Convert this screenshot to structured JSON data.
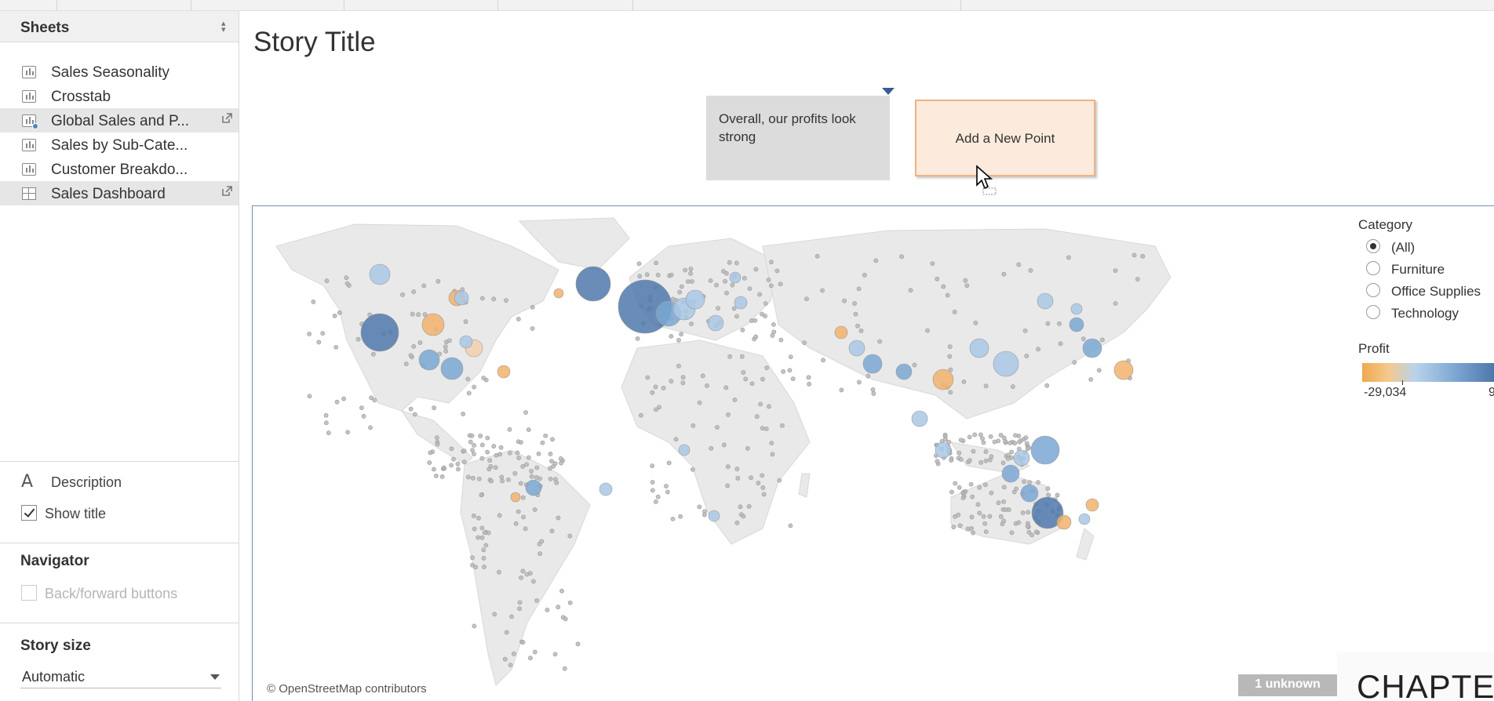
{
  "sidebar": {
    "title": "Sheets",
    "sheets": [
      {
        "label": "Sales Seasonality",
        "kind": "worksheet",
        "selected": false
      },
      {
        "label": "Crosstab",
        "kind": "worksheet",
        "selected": false
      },
      {
        "label": "Global Sales and P...",
        "kind": "worksheet",
        "selected": true
      },
      {
        "label": "Sales by Sub-Cate...",
        "kind": "worksheet",
        "selected": false
      },
      {
        "label": "Customer Breakdo...",
        "kind": "worksheet",
        "selected": false
      },
      {
        "label": "Sales Dashboard",
        "kind": "dashboard",
        "selected": true
      }
    ],
    "description_label": "Description",
    "show_title_label": "Show title",
    "show_title_checked": true,
    "navigator_title": "Navigator",
    "back_forward_label": "Back/forward buttons",
    "story_size_title": "Story size",
    "story_size_value": "Automatic"
  },
  "story": {
    "title": "Story Title",
    "point_caption": "Overall, our profits look strong",
    "add_point_label": "Add a New Point"
  },
  "map": {
    "attribution": "© OpenStreetMap contributors",
    "unknown_badge": "1 unknown"
  },
  "legend": {
    "category_title": "Category",
    "options": [
      "(All)",
      "Furniture",
      "Office Supplies",
      "Technology"
    ],
    "selected": "(All)",
    "profit_title": "Profit",
    "profit_min": "-29,034",
    "profit_max": "9"
  },
  "overlay": {
    "chapter_text": "CHAPTE"
  },
  "colors": {
    "accent": "#3b5a8f",
    "negative_profit": "#f0a84f",
    "positive_profit": "#4a76a8",
    "land": "#e9e9e9"
  }
}
